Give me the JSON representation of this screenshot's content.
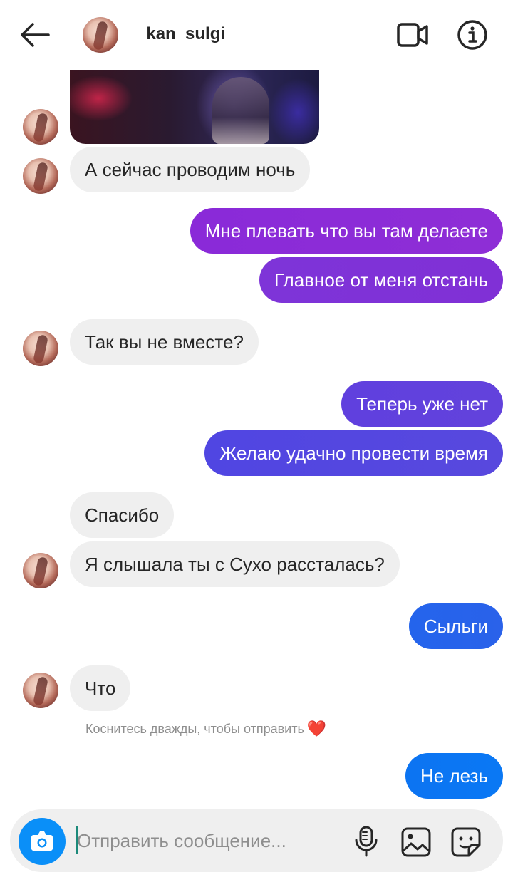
{
  "header": {
    "username": "_kan_sulgi_",
    "back_icon": "back-arrow-icon",
    "video_icon": "video-call-icon",
    "info_icon": "info-icon"
  },
  "messages": [
    {
      "side": "in",
      "type": "photo"
    },
    {
      "side": "in",
      "text": "А сейчас проводим ночь"
    },
    {
      "side": "out",
      "text": "Мне плевать что вы там делаете"
    },
    {
      "side": "out",
      "text": "Главное от меня отстань"
    },
    {
      "side": "in",
      "text": "Так вы не вместе?"
    },
    {
      "side": "out",
      "text": "Теперь уже нет"
    },
    {
      "side": "out",
      "text": "Желаю удачно провести время"
    },
    {
      "side": "in",
      "text": "Спасибо"
    },
    {
      "side": "in",
      "text": "Я слышала ты с Сухо рассталась?"
    },
    {
      "side": "out",
      "text": "Сыльги"
    },
    {
      "side": "in",
      "text": "Что"
    },
    {
      "side": "out",
      "text": "Не лезь"
    }
  ],
  "hint": {
    "text": "Коснитесь дважды, чтобы отправить",
    "emoji": "❤️"
  },
  "composer": {
    "placeholder": "Отправить сообщение...",
    "value": ""
  },
  "colors": {
    "incoming_bubble": "#efefef",
    "outgoing_gradient": [
      "#8e2ed6",
      "#7a3ada",
      "#5a46e0",
      "#3a5ce8",
      "#1a6ef0",
      "#0a78f4"
    ],
    "camera_button": "#0a8ff8",
    "placeholder_text": "#8e8e8e"
  }
}
